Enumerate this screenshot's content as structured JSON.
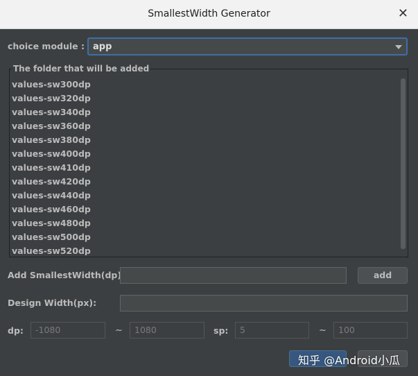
{
  "window": {
    "title": "SmallestWidth Generator",
    "close_glyph": "✕"
  },
  "module": {
    "label": "choice module :",
    "selected": "app"
  },
  "folder_group": {
    "title": "The folder that will be added",
    "items": [
      "values-sw300dp",
      "values-sw320dp",
      "values-sw340dp",
      "values-sw360dp",
      "values-sw380dp",
      "values-sw400dp",
      "values-sw410dp",
      "values-sw420dp",
      "values-sw440dp",
      "values-sw460dp",
      "values-sw480dp",
      "values-sw500dp",
      "values-sw520dp"
    ]
  },
  "add_sw": {
    "label": "Add SmallestWidth(dp):",
    "value": "",
    "button": "add"
  },
  "design_width": {
    "label": "Design Width(px):",
    "value": ""
  },
  "dp": {
    "label": "dp:",
    "from_placeholder": "-1080",
    "to_placeholder": "1080",
    "tilde": "~"
  },
  "sp": {
    "label": "sp:",
    "from_placeholder": "5",
    "to_placeholder": "100",
    "tilde": "~"
  },
  "watermark": "知乎 @Android小瓜",
  "colors": {
    "accent": "#3d6fa8",
    "background": "#3c3f41",
    "primary_button": "#365880"
  }
}
